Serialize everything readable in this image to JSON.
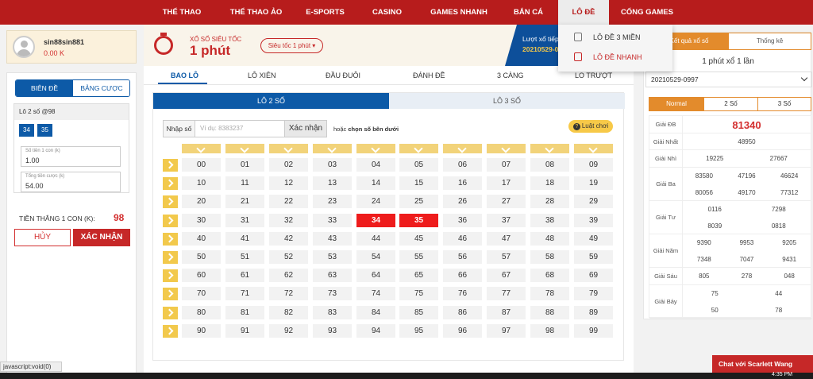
{
  "topnav": {
    "items": [
      "THỂ THAO",
      "THỂ THAO ẢO",
      "E-SPORTS",
      "CASINO",
      "GAMES NHANH",
      "BẮN CÁ",
      "LÔ ĐỀ",
      "CỔNG GAMES"
    ],
    "active": "LÔ ĐỀ"
  },
  "dropdown": {
    "items": [
      "LÔ ĐỀ 3 MIỀN",
      "LÔ ĐỀ NHANH"
    ]
  },
  "user": {
    "name": "sin88sin881",
    "balance": "0.00 K"
  },
  "betslip": {
    "tabs": [
      "BIÊN ĐỀ",
      "BẢNG CƯỢC"
    ],
    "bet_title": "Lô 2 số @98",
    "selected": [
      "34",
      "35"
    ],
    "stake_label": "Số tiền 1 con (k)",
    "stake_value": "1.00",
    "total_label": "Tổng tiền cược (k)",
    "total_value": "54.00",
    "win_label": "TIỀN THẮNG 1 CON (K):",
    "win_value": "98",
    "cancel": "HỦY",
    "confirm": "XÁC NHẬN"
  },
  "header": {
    "subtitle": "XỔ SỐ SIÊU TỐC",
    "title": "1 phút",
    "select": "Siêu tốc 1 phút ▾",
    "next_label": "Lượt xổ tiếp",
    "next_value": "20210529-0"
  },
  "subtabs": [
    "BAO LÔ",
    "LÔ XIÊN",
    "ĐẦU ĐUÔI",
    "ĐÁNH ĐỀ",
    "3 CÀNG",
    "LO TRƯỢT"
  ],
  "game": {
    "tabs": [
      "LÔ 2 SỐ",
      "LÔ 3 SỐ"
    ],
    "input_label": "Nhập số",
    "input_placeholder": "Ví dụ: 8383237",
    "input_button": "Xác nhận",
    "or_text_prefix": "hoặc",
    "or_text_bold": "chọn số bên dưới",
    "rules": "Luật chơi",
    "selected_numbers": [
      "34",
      "35"
    ],
    "accent": "#0d5aa7",
    "selected_color": "#ee1c1c"
  },
  "results": {
    "tabs": [
      "Kết quả xổ số",
      "Thống kê"
    ],
    "title": "1 phút xổ 1 lần",
    "draw": "20210529-0997",
    "modes": [
      "Normal",
      "2 Số",
      "3 Số"
    ],
    "rows": [
      {
        "name": "Giải ĐB",
        "values": [
          "81340"
        ]
      },
      {
        "name": "Giải Nhất",
        "values": [
          "48950"
        ]
      },
      {
        "name": "Giải Nhì",
        "values": [
          "19225",
          "27667"
        ]
      },
      {
        "name": "Giải Ba",
        "values": [
          "83580",
          "47196",
          "46624",
          "80056",
          "49170",
          "77312"
        ]
      },
      {
        "name": "Giải Tư",
        "values": [
          "0116",
          "7298",
          "8039",
          "0818"
        ]
      },
      {
        "name": "Giải Năm",
        "values": [
          "9390",
          "9953",
          "9205",
          "7348",
          "7047",
          "9431"
        ]
      },
      {
        "name": "Giải Sáu",
        "values": [
          "805",
          "278",
          "048"
        ]
      },
      {
        "name": "Giải Bảy",
        "values": [
          "75",
          "44",
          "50",
          "78"
        ]
      }
    ]
  },
  "chat": "Chat với Scarlett Wang",
  "statusbar": "javascript:void(0)",
  "clock": "4:35 PM"
}
